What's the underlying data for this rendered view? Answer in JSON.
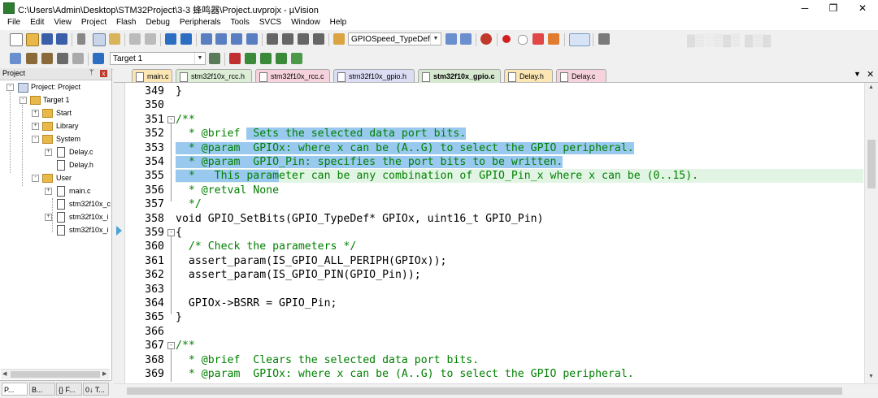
{
  "window": {
    "title": "C:\\Users\\Admin\\Desktop\\STM32Project\\3-3 蜂鸣器\\Project.uvprojx - µVision",
    "minimize": "─",
    "maximize": "❐",
    "close": "✕"
  },
  "menu": [
    "File",
    "Edit",
    "View",
    "Project",
    "Flash",
    "Debug",
    "Peripherals",
    "Tools",
    "SVCS",
    "Window",
    "Help"
  ],
  "toolbar": {
    "find_combo": "GPIOSpeed_TypeDef",
    "target_combo": "Target 1"
  },
  "project_panel": {
    "header": "Project",
    "pin": "ᛘ",
    "close": "x",
    "tree": [
      {
        "label": "Project: Project"
      },
      {
        "label": "Target 1"
      },
      {
        "label": "Start"
      },
      {
        "label": "Library"
      },
      {
        "label": "System"
      },
      {
        "label": "Delay.c"
      },
      {
        "label": "Delay.h"
      },
      {
        "label": "User"
      },
      {
        "label": "main.c"
      },
      {
        "label": "stm32f10x_c"
      },
      {
        "label": "stm32f10x_i"
      },
      {
        "label": "stm32f10x_i"
      }
    ],
    "bottom_tabs": [
      "P...",
      "B...",
      "{} F...",
      "0↓ T..."
    ]
  },
  "editor": {
    "tabs": [
      "main.c",
      "stm32f10x_rcc.h",
      "stm32f10x_rcc.c",
      "stm32f10x_gpio.h",
      "stm32f10x_gpio.c",
      "Delay.h",
      "Delay.c"
    ],
    "active_tab": "stm32f10x_gpio.c",
    "tab_menu": "▼",
    "tab_close": "✕",
    "line_numbers": [
      "349",
      "350",
      "351",
      "352",
      "353",
      "354",
      "355",
      "356",
      "357",
      "358",
      "359",
      "360",
      "361",
      "362",
      "363",
      "364",
      "365",
      "366",
      "367",
      "368",
      "369"
    ],
    "lines": {
      "l349": "}",
      "l351": "/**",
      "l352a": "  * @brief ",
      "l352b": " Sets the selected data port bits.",
      "l353": "  * @param  GPIOx: where x can be (A..G) to select the GPIO peripheral.",
      "l354": "  * @param  GPIO_Pin: specifies the port bits to be written.",
      "l355a": "  *   This param",
      "l355b": "eter can be any combination of GPIO_Pin_x where x can be (0..15).",
      "l356": "  * @retval None",
      "l357": "  */",
      "l358": "void GPIO_SetBits(GPIO_TypeDef* GPIOx, uint16_t GPIO_Pin)",
      "l359": "{",
      "l360": "  /* Check the parameters */",
      "l361": "  assert_param(IS_GPIO_ALL_PERIPH(GPIOx));",
      "l362": "  assert_param(IS_GPIO_PIN(GPIO_Pin));",
      "l364": "  GPIOx->BSRR = GPIO_Pin;",
      "l365": "}",
      "l367": "/**",
      "l368": "  * @brief  Clears the selected data port bits.",
      "l369": "  * @param  GPIOx: where x can be (A..G) to select the GPIO peripheral."
    }
  },
  "colors": {
    "comment": "#008000",
    "selection": "#99c9ef",
    "current_line": "#e2f5e4",
    "keyword": "#00008b"
  }
}
